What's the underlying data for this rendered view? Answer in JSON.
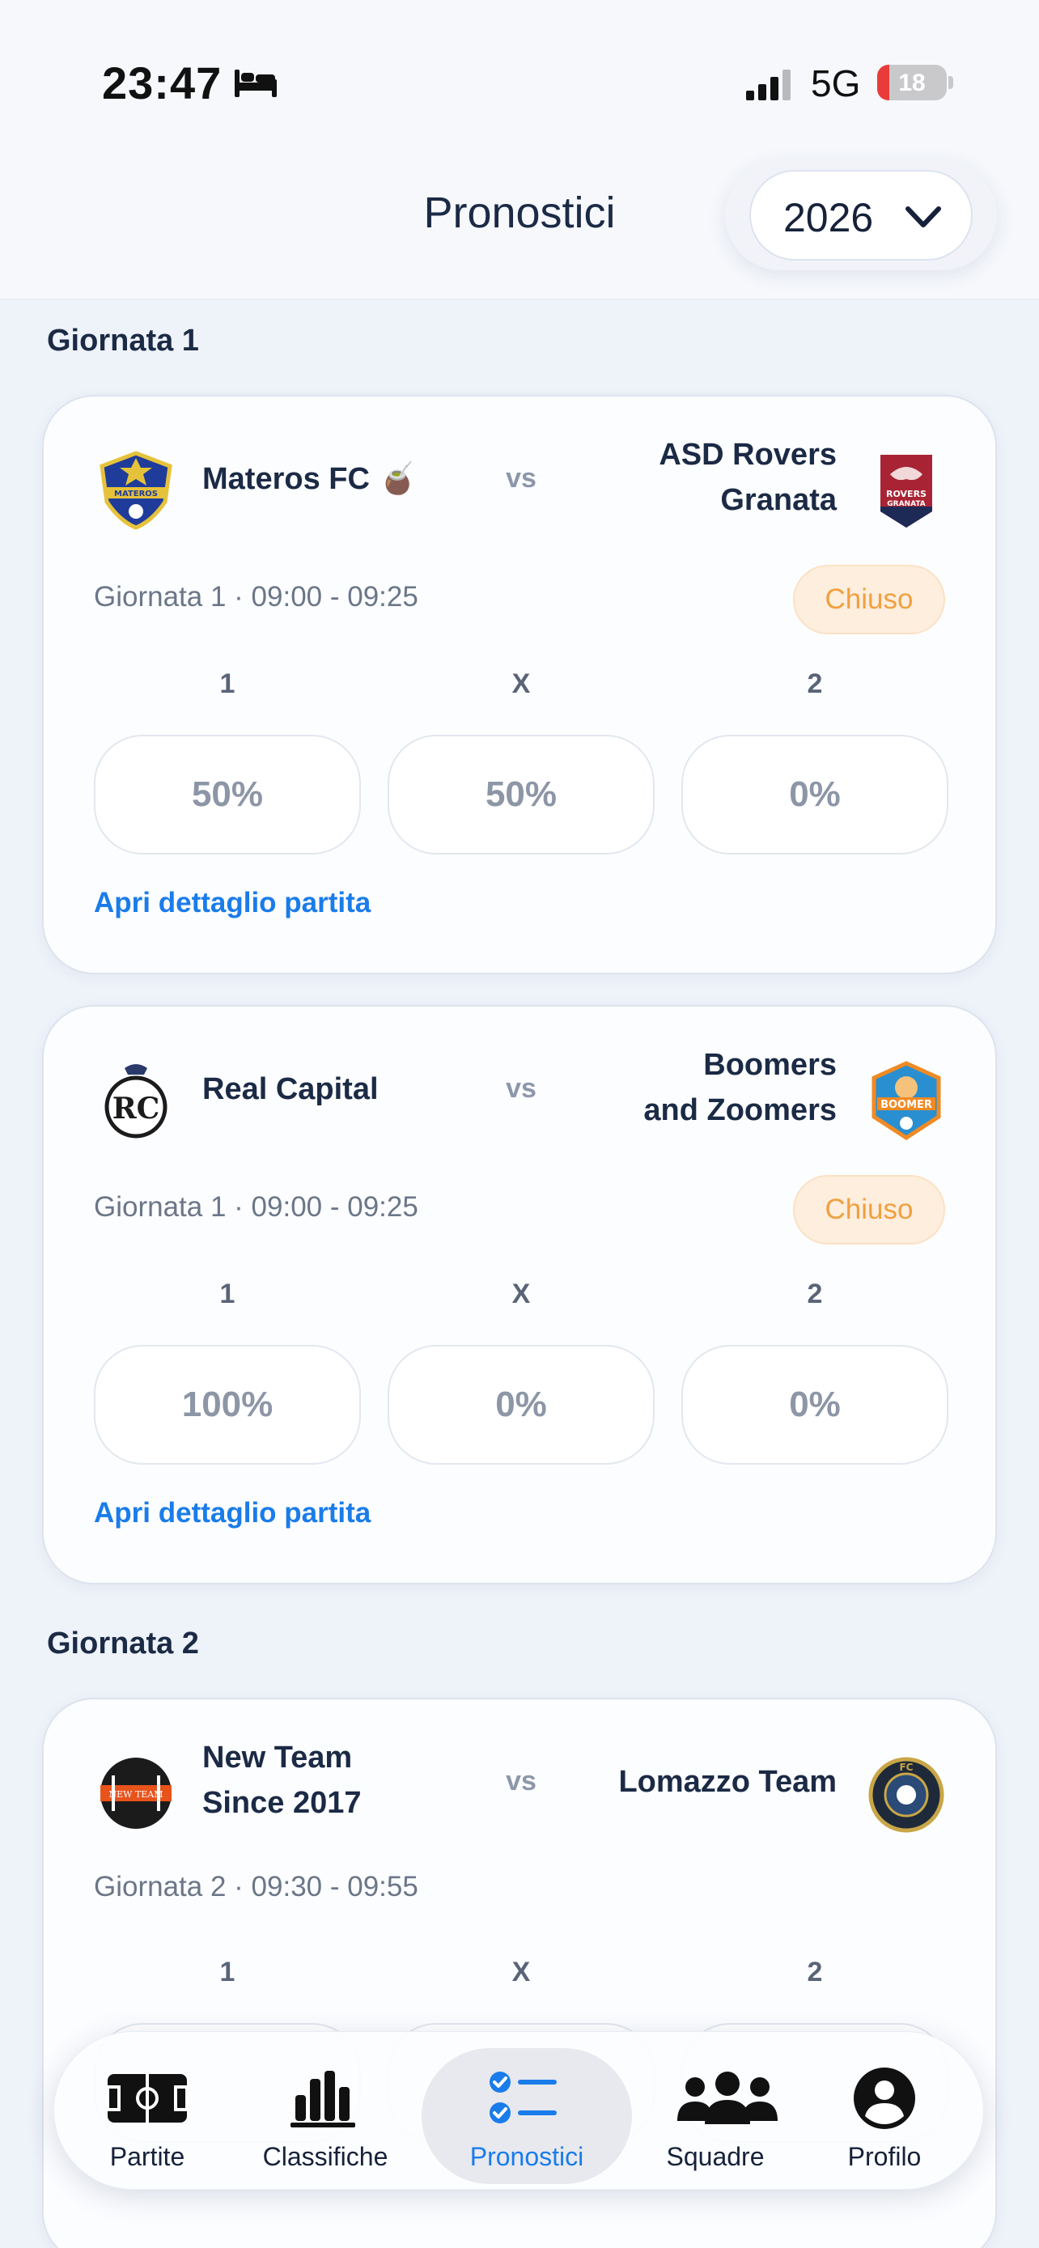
{
  "status_bar": {
    "time": "23:47",
    "network": "5G",
    "battery": "18",
    "battery_level": 0.18
  },
  "header": {
    "title": "Pronostici",
    "year": "2026"
  },
  "sections": [
    {
      "title": "Giornata 1",
      "matches": [
        {
          "home_name_lines": [
            "Materos FC 🧉"
          ],
          "away_name_lines": [
            "ASD Rovers",
            "Granata"
          ],
          "home_logo_text": "MATEROS",
          "away_logo_text": "ROVERS GRANATA",
          "vs": "vs",
          "info": "Giornata 1 · 09:00 - 09:25",
          "status": "Chiuso",
          "options": [
            "1",
            "X",
            "2"
          ],
          "percentages": [
            "50%",
            "50%",
            "0%"
          ],
          "detail_link": "Apri dettaglio partita"
        },
        {
          "home_name_lines": [
            "Real Capital"
          ],
          "away_name_lines": [
            "Boomers",
            "and Zoomers"
          ],
          "home_logo_text": "RC",
          "away_logo_text": "BOOMER",
          "vs": "vs",
          "info": "Giornata 1 · 09:00 - 09:25",
          "status": "Chiuso",
          "options": [
            "1",
            "X",
            "2"
          ],
          "percentages": [
            "100%",
            "0%",
            "0%"
          ],
          "detail_link": "Apri dettaglio partita"
        }
      ]
    },
    {
      "title": "Giornata 2",
      "matches": [
        {
          "home_name_lines": [
            "New Team",
            "Since 2017"
          ],
          "away_name_lines": [
            "Lomazzo Team"
          ],
          "home_logo_text": "NEW TEAM",
          "away_logo_text": "FC",
          "vs": "vs",
          "info": "Giornata 2 · 09:30 - 09:55",
          "options": [
            "1",
            "X",
            "2"
          ]
        }
      ]
    }
  ],
  "tab_bar": {
    "items": [
      {
        "label": "Partite",
        "icon": "field-icon"
      },
      {
        "label": "Classifiche",
        "icon": "bar-chart-icon"
      },
      {
        "label": "Pronostici",
        "icon": "checklist-icon",
        "active": true
      },
      {
        "label": "Squadre",
        "icon": "people-icon"
      },
      {
        "label": "Profilo",
        "icon": "person-icon"
      }
    ]
  },
  "colors": {
    "accent": "#1a7cea",
    "status_closed": "#f0a040",
    "background": "#eef2f9"
  }
}
